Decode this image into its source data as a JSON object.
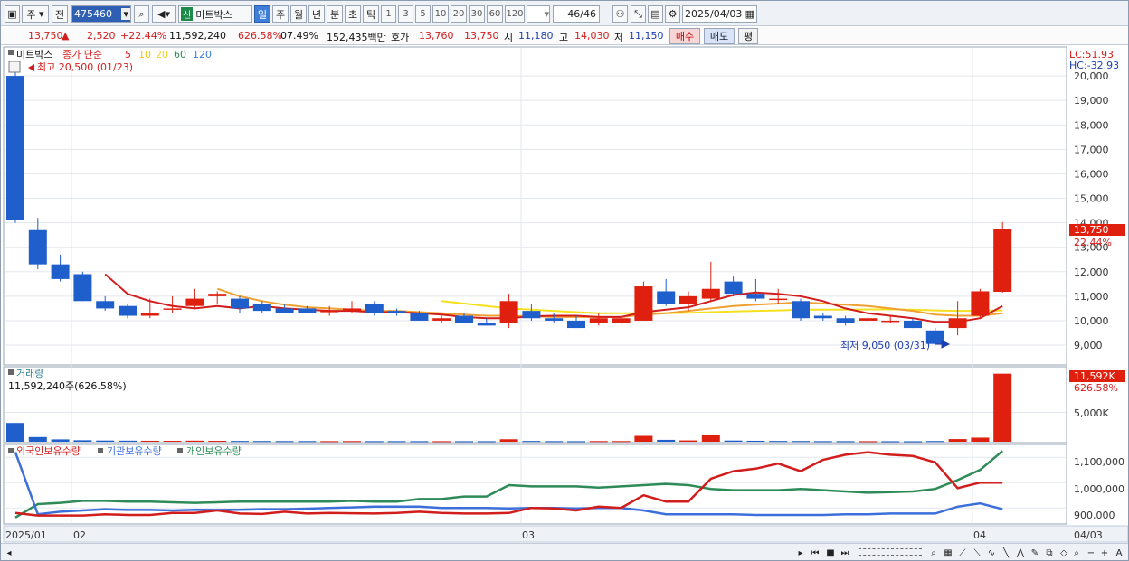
{
  "toolbar": {
    "period_type": "주",
    "prev_label": "전",
    "stock_code": "475460",
    "new_badge": "신",
    "stock_name": "미트박스",
    "interval_tabs": [
      "일",
      "주",
      "월",
      "년",
      "분",
      "초",
      "틱"
    ],
    "active_interval": "일",
    "minute_options": [
      "1",
      "3",
      "5",
      "10",
      "20",
      "30",
      "60",
      "120"
    ],
    "count_value": "46/46",
    "date_value": "2025/04/03"
  },
  "quote": {
    "price": "13,750",
    "up_arrow": "▲",
    "change": "2,520",
    "change_pct": "+22.44%",
    "volume": "11,592,240",
    "volume_ratio": "626.58%",
    "turnover": "07.49%",
    "amount": "152,435백만",
    "bid_label": "호가",
    "ask_price": "13,760",
    "bid_price": "13,750",
    "open_label": "시",
    "open": "11,180",
    "high_label": "고",
    "high": "14,030",
    "low_label": "저",
    "low": "11,150",
    "buy_btn": "매수",
    "sell_btn": "매도",
    "flat_btn": "평"
  },
  "price_pane": {
    "name_tag": "미트박스",
    "ma_label": "종가 단순",
    "ma_periods": [
      "5",
      "10",
      "20",
      "60",
      "120"
    ],
    "ma_colors": [
      "#d21d1d",
      "#f1c40f",
      "#f0d020",
      "#2e8b57",
      "#3d7edb"
    ],
    "high_note": "최고 20,500 (01/23)",
    "low_note": "최저 9,050 (03/31)",
    "lc": "LC:51.93",
    "hc": "HC:-32.93",
    "current_price_tag": "13,750",
    "current_pct_tag": "22.44%",
    "y_ticks": [
      "20,000",
      "19,000",
      "18,000",
      "17,000",
      "16,000",
      "15,000",
      "14,000",
      "13,000",
      "12,000",
      "11,000",
      "10,000",
      "9,000"
    ]
  },
  "volume_pane": {
    "label": "거래량",
    "readout": "11,592,240주(626.58%)",
    "tag_value": "11,592K",
    "tag_pct": "626.58%",
    "y_tick": "5,000K"
  },
  "holdings_pane": {
    "labels": [
      "외국인보유수량",
      "기관보유수량",
      "개인보유수량"
    ],
    "colors": [
      "#d21d1d",
      "#3d6fdb",
      "#2e8b57"
    ],
    "y_ticks": [
      "1,100,000",
      "1,000,000",
      "900,000"
    ]
  },
  "x_axis": {
    "labels": [
      "2025/01",
      "02",
      "03",
      "04",
      "04/03"
    ]
  },
  "colors": {
    "up": "#e0200f",
    "down": "#1f5fcc",
    "ma5": "#d21d1d",
    "ma10": "#f0a030",
    "ma20": "#f5e020"
  },
  "chart_data": {
    "type": "candlestick",
    "candles": [
      {
        "o": 20000,
        "h": 20500,
        "l": 14000,
        "c": 14100
      },
      {
        "o": 13700,
        "h": 14200,
        "l": 12100,
        "c": 12300
      },
      {
        "o": 12300,
        "h": 12700,
        "l": 11600,
        "c": 11700
      },
      {
        "o": 11900,
        "h": 12000,
        "l": 10800,
        "c": 10800
      },
      {
        "o": 10800,
        "h": 11000,
        "l": 10400,
        "c": 10500
      },
      {
        "o": 10600,
        "h": 10700,
        "l": 10100,
        "c": 10200
      },
      {
        "o": 10200,
        "h": 10900,
        "l": 10100,
        "c": 10300
      },
      {
        "o": 10500,
        "h": 11000,
        "l": 10300,
        "c": 10500
      },
      {
        "o": 10600,
        "h": 11300,
        "l": 10500,
        "c": 10900
      },
      {
        "o": 11000,
        "h": 11200,
        "l": 10700,
        "c": 11100
      },
      {
        "o": 10900,
        "h": 11000,
        "l": 10300,
        "c": 10500
      },
      {
        "o": 10700,
        "h": 10800,
        "l": 10300,
        "c": 10400
      },
      {
        "o": 10500,
        "h": 10700,
        "l": 10300,
        "c": 10300
      },
      {
        "o": 10500,
        "h": 10600,
        "l": 10300,
        "c": 10300
      },
      {
        "o": 10400,
        "h": 10600,
        "l": 10200,
        "c": 10400
      },
      {
        "o": 10400,
        "h": 10800,
        "l": 10300,
        "c": 10500
      },
      {
        "o": 10700,
        "h": 10800,
        "l": 10200,
        "c": 10300
      },
      {
        "o": 10400,
        "h": 10500,
        "l": 10200,
        "c": 10300
      },
      {
        "o": 10300,
        "h": 10400,
        "l": 10000,
        "c": 10000
      },
      {
        "o": 10000,
        "h": 10200,
        "l": 9900,
        "c": 10100
      },
      {
        "o": 10200,
        "h": 10300,
        "l": 9900,
        "c": 9900
      },
      {
        "o": 9900,
        "h": 10100,
        "l": 9800,
        "c": 9800
      },
      {
        "o": 9900,
        "h": 11100,
        "l": 9700,
        "c": 10800
      },
      {
        "o": 10400,
        "h": 10700,
        "l": 10000,
        "c": 10100
      },
      {
        "o": 10100,
        "h": 10300,
        "l": 9900,
        "c": 10000
      },
      {
        "o": 10000,
        "h": 10200,
        "l": 9700,
        "c": 9700
      },
      {
        "o": 9900,
        "h": 10300,
        "l": 9800,
        "c": 10100
      },
      {
        "o": 9900,
        "h": 10200,
        "l": 9800,
        "c": 10100
      },
      {
        "o": 10000,
        "h": 11600,
        "l": 10000,
        "c": 11400
      },
      {
        "o": 11200,
        "h": 11700,
        "l": 10600,
        "c": 10700
      },
      {
        "o": 10700,
        "h": 11200,
        "l": 10400,
        "c": 11000
      },
      {
        "o": 10900,
        "h": 12400,
        "l": 10800,
        "c": 11300
      },
      {
        "o": 11600,
        "h": 11800,
        "l": 11000,
        "c": 11100
      },
      {
        "o": 11100,
        "h": 11700,
        "l": 10800,
        "c": 10900
      },
      {
        "o": 10900,
        "h": 11300,
        "l": 10700,
        "c": 10900
      },
      {
        "o": 10800,
        "h": 10900,
        "l": 10000,
        "c": 10100
      },
      {
        "o": 10200,
        "h": 10300,
        "l": 10000,
        "c": 10100
      },
      {
        "o": 10100,
        "h": 10200,
        "l": 9800,
        "c": 9900
      },
      {
        "o": 10000,
        "h": 10200,
        "l": 9900,
        "c": 10100
      },
      {
        "o": 10000,
        "h": 10200,
        "l": 9900,
        "c": 10000
      },
      {
        "o": 10000,
        "h": 10100,
        "l": 9700,
        "c": 9700
      },
      {
        "o": 9600,
        "h": 9700,
        "l": 9050,
        "c": 9050
      },
      {
        "o": 9700,
        "h": 10800,
        "l": 9400,
        "c": 10100
      },
      {
        "o": 10200,
        "h": 11300,
        "l": 10100,
        "c": 11200
      },
      {
        "o": 11180,
        "h": 14030,
        "l": 11150,
        "c": 13750
      }
    ],
    "ma5": [
      null,
      null,
      null,
      null,
      11900,
      11100,
      10800,
      10600,
      10500,
      10600,
      10500,
      10600,
      10500,
      10450,
      10400,
      10400,
      10350,
      10350,
      10300,
      10250,
      10150,
      10100,
      10100,
      10180,
      10200,
      10200,
      10150,
      10150,
      10350,
      10450,
      10550,
      10800,
      11050,
      11150,
      11100,
      11000,
      10800,
      10500,
      10300,
      10200,
      10100,
      9950,
      9950,
      10100,
      10600
    ],
    "ma10": [
      null,
      null,
      null,
      null,
      null,
      null,
      null,
      null,
      null,
      11300,
      11000,
      10800,
      10650,
      10550,
      10500,
      10450,
      10400,
      10400,
      10350,
      10300,
      10250,
      10200,
      10200,
      10180,
      10150,
      10150,
      10150,
      10150,
      10250,
      10300,
      10400,
      10500,
      10600,
      10650,
      10700,
      10750,
      10700,
      10650,
      10600,
      10500,
      10400,
      10250,
      10200,
      10200,
      10300
    ],
    "ma20": [
      null,
      null,
      null,
      null,
      null,
      null,
      null,
      null,
      null,
      null,
      null,
      null,
      null,
      null,
      null,
      null,
      null,
      null,
      null,
      10800,
      10700,
      10600,
      10500,
      10450,
      10400,
      10350,
      10300,
      10300,
      10300,
      10300,
      10320,
      10350,
      10380,
      10400,
      10420,
      10450,
      10450,
      10450,
      10460,
      10460,
      10450,
      10420,
      10400,
      10400,
      10420
    ],
    "volume_k": [
      3200,
      800,
      400,
      250,
      200,
      180,
      160,
      150,
      180,
      150,
      130,
      120,
      110,
      110,
      100,
      110,
      100,
      100,
      95,
      90,
      90,
      90,
      420,
      130,
      100,
      90,
      110,
      110,
      1000,
      320,
      220,
      1150,
      200,
      160,
      130,
      120,
      100,
      95,
      90,
      85,
      80,
      120,
      450,
      700,
      11592
    ],
    "volume_up": [
      false,
      false,
      false,
      false,
      false,
      false,
      true,
      true,
      true,
      true,
      false,
      false,
      false,
      false,
      true,
      true,
      false,
      false,
      false,
      true,
      false,
      false,
      true,
      false,
      false,
      false,
      true,
      true,
      true,
      false,
      true,
      true,
      false,
      false,
      false,
      false,
      false,
      false,
      true,
      false,
      false,
      false,
      true,
      true,
      true
    ],
    "foreign": [
      880000,
      870000,
      870000,
      870000,
      875000,
      872000,
      872000,
      880000,
      880000,
      890000,
      878000,
      876000,
      885000,
      878000,
      880000,
      879000,
      878000,
      880000,
      885000,
      880000,
      878000,
      878000,
      880000,
      900000,
      898000,
      890000,
      905000,
      900000,
      950000,
      925000,
      925000,
      1015000,
      1045000,
      1055000,
      1075000,
      1045000,
      1090000,
      1110000,
      1120000,
      1110000,
      1105000,
      1080000,
      978000,
      1000000,
      1000000
    ],
    "institution": [
      1120000,
      875000,
      885000,
      890000,
      895000,
      892000,
      892000,
      890000,
      893000,
      892000,
      893000,
      895000,
      895000,
      897000,
      900000,
      902000,
      905000,
      905000,
      905000,
      900000,
      900000,
      900000,
      898000,
      900000,
      900000,
      898000,
      900000,
      900000,
      890000,
      875000,
      875000,
      875000,
      875000,
      872000,
      872000,
      872000,
      872000,
      875000,
      875000,
      878000,
      878000,
      878000,
      905000,
      918000,
      895000
    ],
    "individual": [
      862000,
      915000,
      920000,
      928000,
      928000,
      925000,
      925000,
      922000,
      920000,
      922000,
      925000,
      925000,
      925000,
      925000,
      925000,
      928000,
      925000,
      925000,
      935000,
      935000,
      945000,
      945000,
      990000,
      985000,
      985000,
      985000,
      980000,
      985000,
      990000,
      995000,
      990000,
      975000,
      970000,
      970000,
      970000,
      975000,
      970000,
      965000,
      960000,
      962000,
      965000,
      975000,
      1010000,
      1050000,
      1125000
    ],
    "price_range": [
      8300,
      21000
    ],
    "holdings_range": [
      840000,
      1140000
    ]
  }
}
